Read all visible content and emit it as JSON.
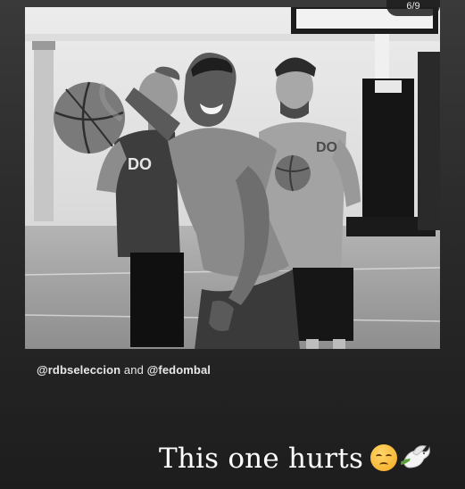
{
  "story": {
    "page_indicator": "6/9",
    "mentions": {
      "handle_1": "@rdbseleccion",
      "connector": "and",
      "handle_2": "@fedombal"
    },
    "caption": {
      "text": "This one hurts",
      "emoji_1": "disappointed-face-emoji",
      "emoji_2": "dove-with-olive-branch-emoji"
    },
    "photo": {
      "description_icon": "basketball-practice-photo",
      "shirt_text_left": "DO",
      "shirt_text_right": "DO"
    }
  }
}
